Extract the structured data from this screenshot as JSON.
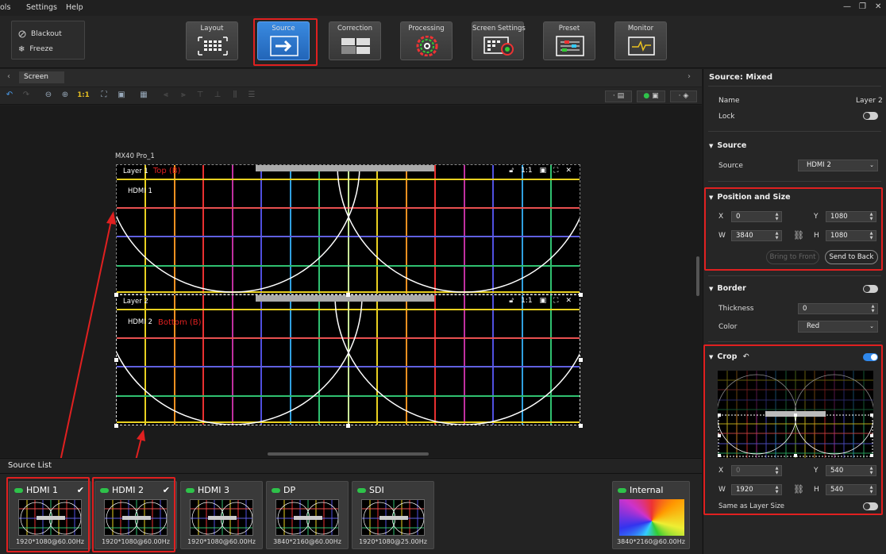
{
  "menu": {
    "items": [
      "ols",
      "Settings",
      "Help"
    ]
  },
  "controls": {
    "blackout": "Blackout",
    "freeze": "Freeze"
  },
  "toolbar_buttons": [
    {
      "label": "Layout",
      "icon": "layout-grid-icon"
    },
    {
      "label": "Source",
      "icon": "source-arrow-icon"
    },
    {
      "label": "Correction",
      "icon": "correction-icon"
    },
    {
      "label": "Processing",
      "icon": "color-wheel-icon"
    },
    {
      "label": "Screen Settings",
      "icon": "screen-settings-icon"
    },
    {
      "label": "Preset",
      "icon": "preset-sliders-icon"
    },
    {
      "label": "Monitor",
      "icon": "monitor-wave-icon"
    }
  ],
  "active_button": "Source",
  "screen_tab": "Screen",
  "zoom_label": "1:1",
  "canvas": {
    "screen_name": "MX40 Pro_1",
    "layers": [
      {
        "name": "Layer 1",
        "source": "HDMI 1",
        "annotation": "Top (B)",
        "ratio": "1:1"
      },
      {
        "name": "Layer 2",
        "source": "HDMI 2",
        "annotation": "Bottom (B)",
        "ratio": "1:1"
      }
    ]
  },
  "source_list": {
    "title": "Source List",
    "cards": [
      {
        "name": "HDMI 1",
        "res": "1920*1080@60.00Hz",
        "checked": true
      },
      {
        "name": "HDMI 2",
        "res": "1920*1080@60.00Hz",
        "checked": true
      },
      {
        "name": "HDMI 3",
        "res": "1920*1080@60.00Hz",
        "checked": false
      },
      {
        "name": "DP",
        "res": "3840*2160@60.00Hz",
        "checked": false
      },
      {
        "name": "SDI",
        "res": "1920*1080@25.00Hz",
        "checked": false
      }
    ],
    "internal": {
      "name": "Internal",
      "res": "3840*2160@60.00Hz"
    }
  },
  "panel": {
    "title": "Source: Mixed",
    "name_label": "Name",
    "name_value": "Layer 2",
    "lock_label": "Lock",
    "source_section": "Source",
    "source_label": "Source",
    "source_value": "HDMI 2",
    "pos_section": "Position and Size",
    "x_label": "X",
    "x_value": "0",
    "y_label": "Y",
    "y_value": "1080",
    "w_label": "W",
    "w_value": "3840",
    "h_label": "H",
    "h_value": "1080",
    "bring_front": "Bring to Front",
    "send_back": "Send to Back",
    "border_section": "Border",
    "thickness_label": "Thickness",
    "thickness_value": "0",
    "color_label": "Color",
    "color_value": "Red",
    "crop_section": "Crop",
    "cx_label": "X",
    "cx_value": "0",
    "cy_label": "Y",
    "cy_value": "540",
    "cw_label": "W",
    "cw_value": "1920",
    "ch_label": "H",
    "ch_value": "540",
    "same_size_label": "Same as Layer Size"
  },
  "colors": {
    "accent": "#2f88ec",
    "highlight": "#e02020",
    "status": "#2ec24a"
  }
}
